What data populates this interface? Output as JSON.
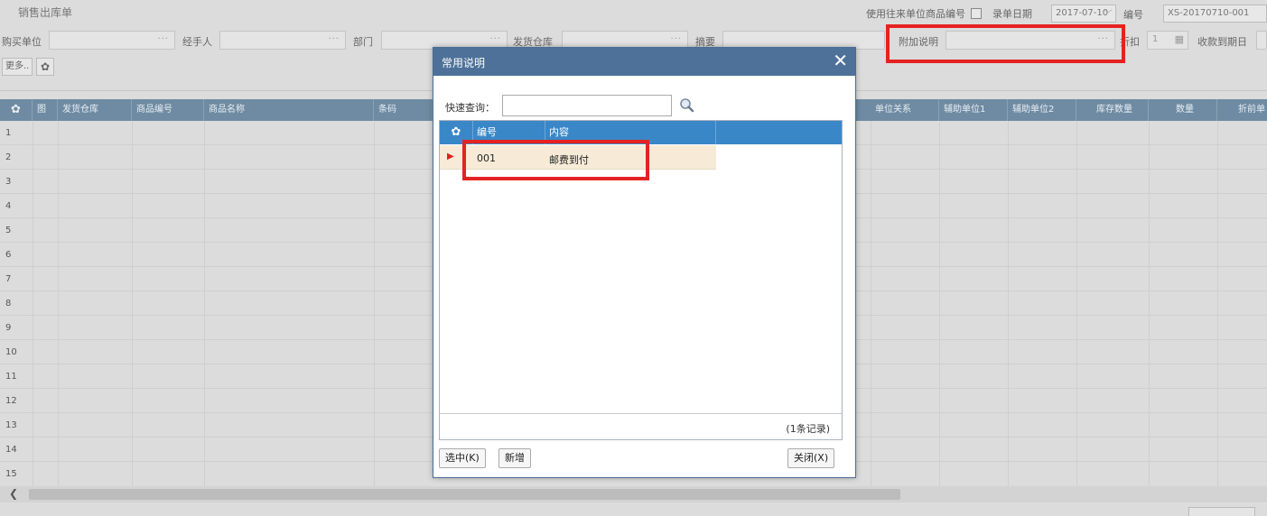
{
  "page": {
    "title": "销售出库单",
    "use_code_label": "使用往来单位商品编号",
    "date_label": "录单日期",
    "date_value": "2017-07-10",
    "number_label": "编号",
    "number_value": "XS-20170710-001"
  },
  "form": {
    "buyer": "购买单位",
    "handler": "经手人",
    "dept": "部门",
    "warehouse": "发货仓库",
    "summary": "摘要",
    "extra_note": "附加说明",
    "discount": "折扣",
    "discount_value": "1",
    "due_date": "收款到期日",
    "more": "更多.."
  },
  "grid": {
    "columns": [
      "图",
      "发货仓库",
      "商品编号",
      "商品名称",
      "条码",
      "单位关系",
      "辅助单位1",
      "辅助单位2",
      "库存数量",
      "数量",
      "折前单"
    ],
    "rows": [
      "1",
      "2",
      "3",
      "4",
      "5",
      "6",
      "7",
      "8",
      "9",
      "10",
      "11",
      "12",
      "13",
      "14",
      "15"
    ]
  },
  "modal": {
    "title": "常用说明",
    "search_label": "快速查询：",
    "search_value": "",
    "col_code": "编号",
    "col_content": "内容",
    "rows": [
      {
        "code": "001",
        "content": "邮费到付"
      }
    ],
    "record_count": "(1条记录)",
    "select_btn": "选中(K)",
    "new_btn": "新增",
    "close_btn": "关闭(X)"
  },
  "icons": {
    "gear": "gear-icon",
    "search": "search-icon",
    "close": "close-icon",
    "calendar": "calendar-icon",
    "scroll_left": "chevron-left-icon",
    "row_marker": "triangle-right-icon"
  },
  "colors": {
    "modal_header": "#4d7199",
    "list_header": "#3a87c8",
    "selected_row": "#f7ebd8",
    "highlight": "#e52222"
  }
}
